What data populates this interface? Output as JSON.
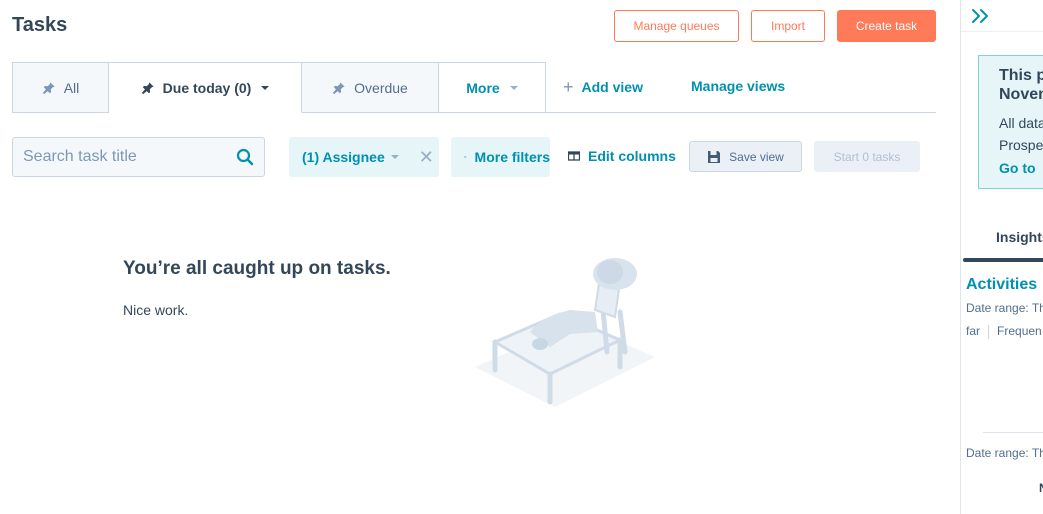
{
  "header": {
    "title": "Tasks",
    "buttons": {
      "manage_queues": "Manage queues",
      "import": "Import",
      "create_task": "Create task"
    }
  },
  "tabs": [
    {
      "label": "All",
      "icon": "pin-icon",
      "active": false
    },
    {
      "label": "Due today (0)",
      "icon": "pin-icon",
      "active": true,
      "has_dropdown": true
    },
    {
      "label": "Overdue",
      "icon": "pin-icon",
      "active": false
    },
    {
      "label": "More",
      "has_dropdown": true
    }
  ],
  "view_actions": {
    "add_view": "Add view",
    "manage_views": "Manage views"
  },
  "toolbar": {
    "search_placeholder": "Search task title",
    "search_value": "",
    "assignee_filter": "(1) Assignee",
    "more_filters": "More filters",
    "edit_columns": "Edit columns",
    "save_view": "Save view",
    "start_tasks": "Start 0 tasks"
  },
  "empty_state": {
    "title": "You’re all caught up on tasks.",
    "subtitle": "Nice work."
  },
  "sidebar": {
    "collapse_icon": "double-chevron-right-icon",
    "notice": {
      "title_line1": "This p",
      "title_line2": "Noven",
      "body_line1": "All data",
      "body_line2": "Prospe",
      "link": "Go to"
    },
    "tab_label": "Insights",
    "section_title": "Activities",
    "date_range_1": "Date range: Th",
    "filter_left": "far",
    "filter_right": "Frequen",
    "date_range_2": "Date range: Th",
    "bottom_text": "N"
  },
  "colors": {
    "accent_orange": "#ff7a59",
    "link_teal": "#0091ae",
    "text_dark": "#33475b",
    "border": "#cbd6e2",
    "filter_bg": "#e5f5f8"
  }
}
